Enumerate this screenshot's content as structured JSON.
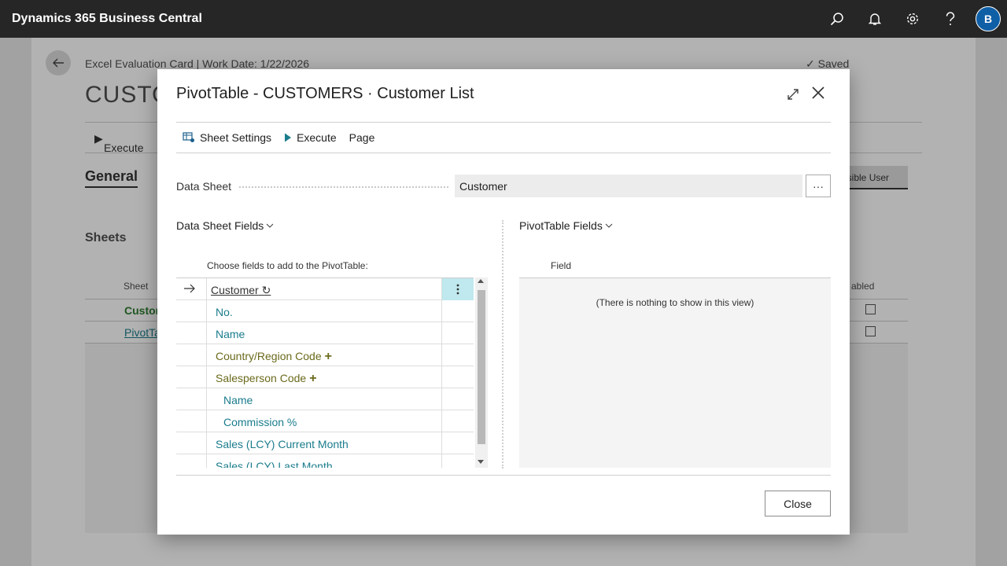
{
  "app": {
    "title": "Dynamics 365 Business Central",
    "user_initial": "B"
  },
  "background": {
    "breadcrumb": "Excel Evaluation Card | Work Date: 1/22/2026",
    "title": "CUSTO",
    "saved": "Saved",
    "execute": "Execute",
    "general": "General",
    "responsible_user": "nsible User",
    "sheets": "Sheets",
    "sheet_header": "Sheet",
    "enabled_header": "abled",
    "rows": [
      "Custor",
      "PivotTa"
    ]
  },
  "dialog": {
    "title": "PivotTable - CUSTOMERS · Customer List",
    "actions": {
      "sheet_settings": "Sheet Settings",
      "execute": "Execute",
      "page": "Page"
    },
    "data_sheet_label": "Data Sheet",
    "data_sheet_value": "Customer",
    "more_button": "···",
    "data_sheet_fields_title": "Data Sheet Fields",
    "pivot_fields_title": "PivotTable Fields",
    "choose_hint": "Choose fields to add to the PivotTable:",
    "table_name": "Customer",
    "fields": [
      {
        "label": "No.",
        "indent": 1,
        "olive": false,
        "plus": false
      },
      {
        "label": "Name",
        "indent": 1,
        "olive": false,
        "plus": false
      },
      {
        "label": "Country/Region Code",
        "indent": 1,
        "olive": true,
        "plus": true
      },
      {
        "label": "Salesperson Code",
        "indent": 1,
        "olive": true,
        "plus": true
      },
      {
        "label": "Name",
        "indent": 2,
        "olive": false,
        "plus": false
      },
      {
        "label": "Commission %",
        "indent": 2,
        "olive": false,
        "plus": false
      },
      {
        "label": "Sales (LCY) Current Month",
        "indent": 1,
        "olive": false,
        "plus": false
      },
      {
        "label": "Sales (LCY) Last Month",
        "indent": 1,
        "olive": false,
        "plus": false
      }
    ],
    "pivot_column_header": "Field",
    "pivot_empty": "(There is nothing to show in this view)",
    "close_button": "Close"
  }
}
